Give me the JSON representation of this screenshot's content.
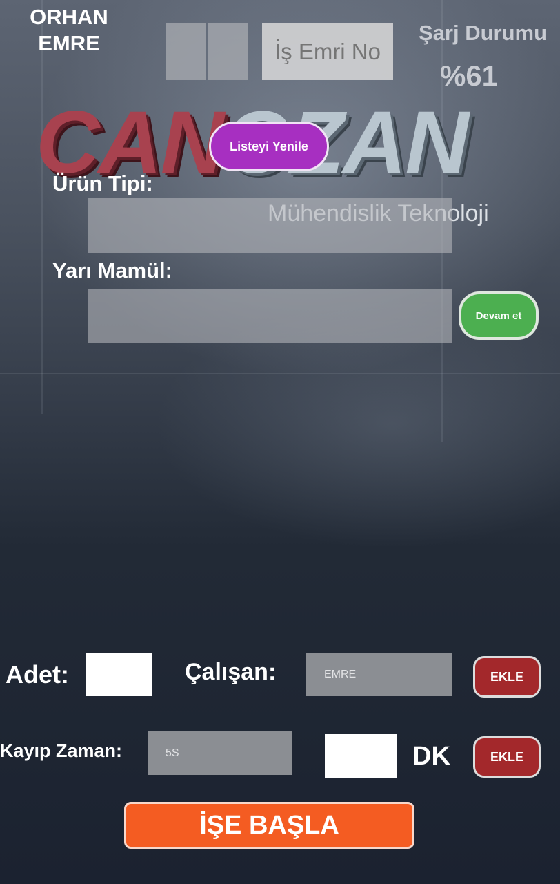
{
  "header": {
    "user_line1": "ORHAN",
    "user_line2": "EMRE",
    "order_placeholder": "İş Emri No",
    "charge_label": "Şarj Durumu",
    "charge_value": "%61"
  },
  "logo": {
    "text_a": "CAN",
    "text_b": "OZAN",
    "subtitle": "Mühendislik Teknoloji"
  },
  "actions": {
    "refresh_label": "Listeyi Yenile",
    "continue_label": "Devam et"
  },
  "form": {
    "product_type_label": "Ürün Tipi:",
    "semi_product_label": "Yarı Mamül:",
    "quantity_label": "Adet:",
    "employee_label": "Çalışan:",
    "employee_value": "EMRE",
    "lost_time_label": "Kayıp Zaman:",
    "lost_time_value": "5S",
    "minutes_unit": "DK",
    "add_label_1": "EKLE",
    "add_label_2": "EKLE",
    "start_label": "İŞE BAŞLA"
  }
}
